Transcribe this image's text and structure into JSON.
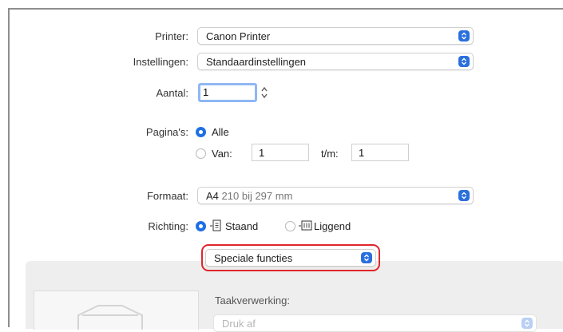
{
  "printer": {
    "label": "Printer:",
    "value": "Canon Printer"
  },
  "settings": {
    "label": "Instellingen:",
    "value": "Standaardinstellingen"
  },
  "copies": {
    "label": "Aantal:",
    "value": "1"
  },
  "pages": {
    "label": "Pagina's:",
    "all_label": "Alle",
    "from_label": "Van:",
    "from_value": "1",
    "to_label": "t/m:",
    "to_value": "1"
  },
  "format": {
    "label": "Formaat:",
    "value": "A4",
    "detail": "210 bij 297 mm"
  },
  "orientation": {
    "label": "Richting:",
    "portrait_label": "Staand",
    "landscape_label": "Liggend"
  },
  "special": {
    "value": "Speciale functies",
    "highlight_color": "#e0262c"
  },
  "job": {
    "label": "Taakverwerking:",
    "value": "Druk af"
  },
  "colors": {
    "accent": "#2b6fde",
    "panel": "#eeeeee"
  }
}
